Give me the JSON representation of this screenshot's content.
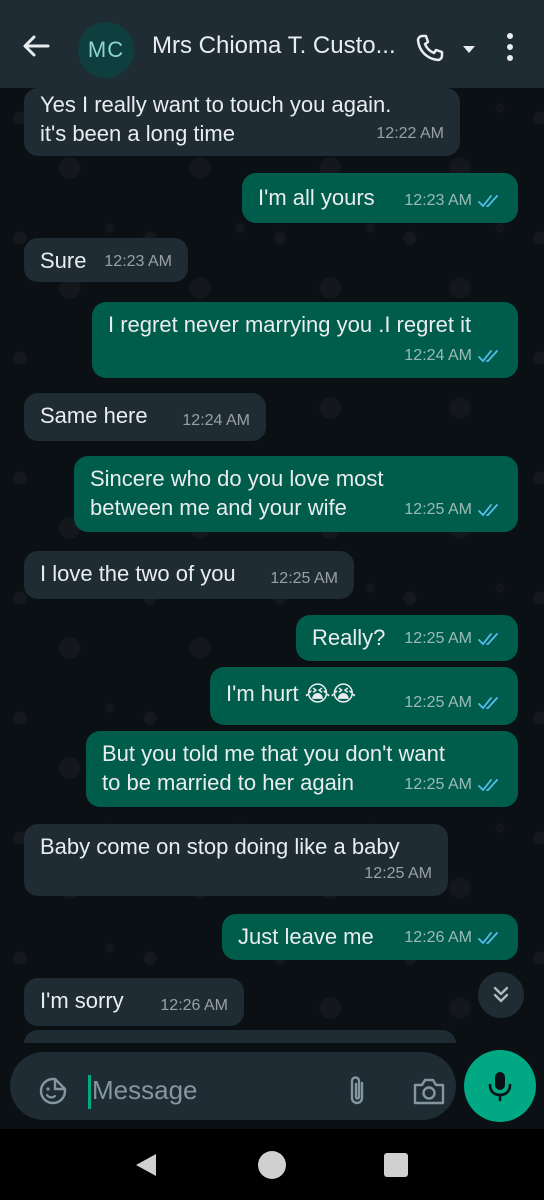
{
  "header": {
    "avatar_initials": "MC",
    "contact_name": "Mrs Chioma T. Custo..."
  },
  "messages": [
    {
      "dir": "in",
      "text": "Yes I really want to touch you again.\nit's been a long time",
      "time": "12:22 AM"
    },
    {
      "dir": "out",
      "text": "I'm all yours",
      "time": "12:23 AM",
      "status": "read"
    },
    {
      "dir": "in",
      "text": "Sure",
      "time": "12:23 AM"
    },
    {
      "dir": "out",
      "text": "I regret never marrying you .I regret it",
      "time": "12:24 AM",
      "status": "read"
    },
    {
      "dir": "in",
      "text": "Same here",
      "time": "12:24 AM"
    },
    {
      "dir": "out",
      "text": "Sincere who do you love most\nbetween me and your wife",
      "time": "12:25 AM",
      "status": "read"
    },
    {
      "dir": "in",
      "text": "I love the two of you",
      "time": "12:25 AM"
    },
    {
      "dir": "out",
      "text": "Really?",
      "time": "12:25 AM",
      "status": "read"
    },
    {
      "dir": "out",
      "text": "I'm hurt 😭😭",
      "time": "12:25 AM",
      "status": "read"
    },
    {
      "dir": "out",
      "text": "But you told me that you don't want\nto be married to her again",
      "time": "12:25 AM",
      "status": "read"
    },
    {
      "dir": "in",
      "text": "Baby come on stop doing like a baby",
      "time": "12:25 AM"
    },
    {
      "dir": "out",
      "text": "Just leave me",
      "time": "12:26 AM",
      "status": "read"
    },
    {
      "dir": "in",
      "text": "I'm sorry",
      "time": "12:26 AM"
    }
  ],
  "composer": {
    "placeholder": "Message"
  },
  "icons": {
    "back": "arrow-left-icon",
    "call": "phone-icon",
    "dropdown": "caret-down-icon",
    "menu": "more-vertical-icon",
    "scroll": "double-chevron-down-icon",
    "emoji": "sticker-icon",
    "attach": "paperclip-icon",
    "camera": "camera-icon",
    "mic": "microphone-icon",
    "read_ticks": "double-check-icon"
  },
  "colors": {
    "header_bg": "#1f2c34",
    "incoming_bubble": "#1f2c34",
    "outgoing_bubble": "#005c4b",
    "accent": "#00a884",
    "read_tick": "#53bdeb"
  }
}
